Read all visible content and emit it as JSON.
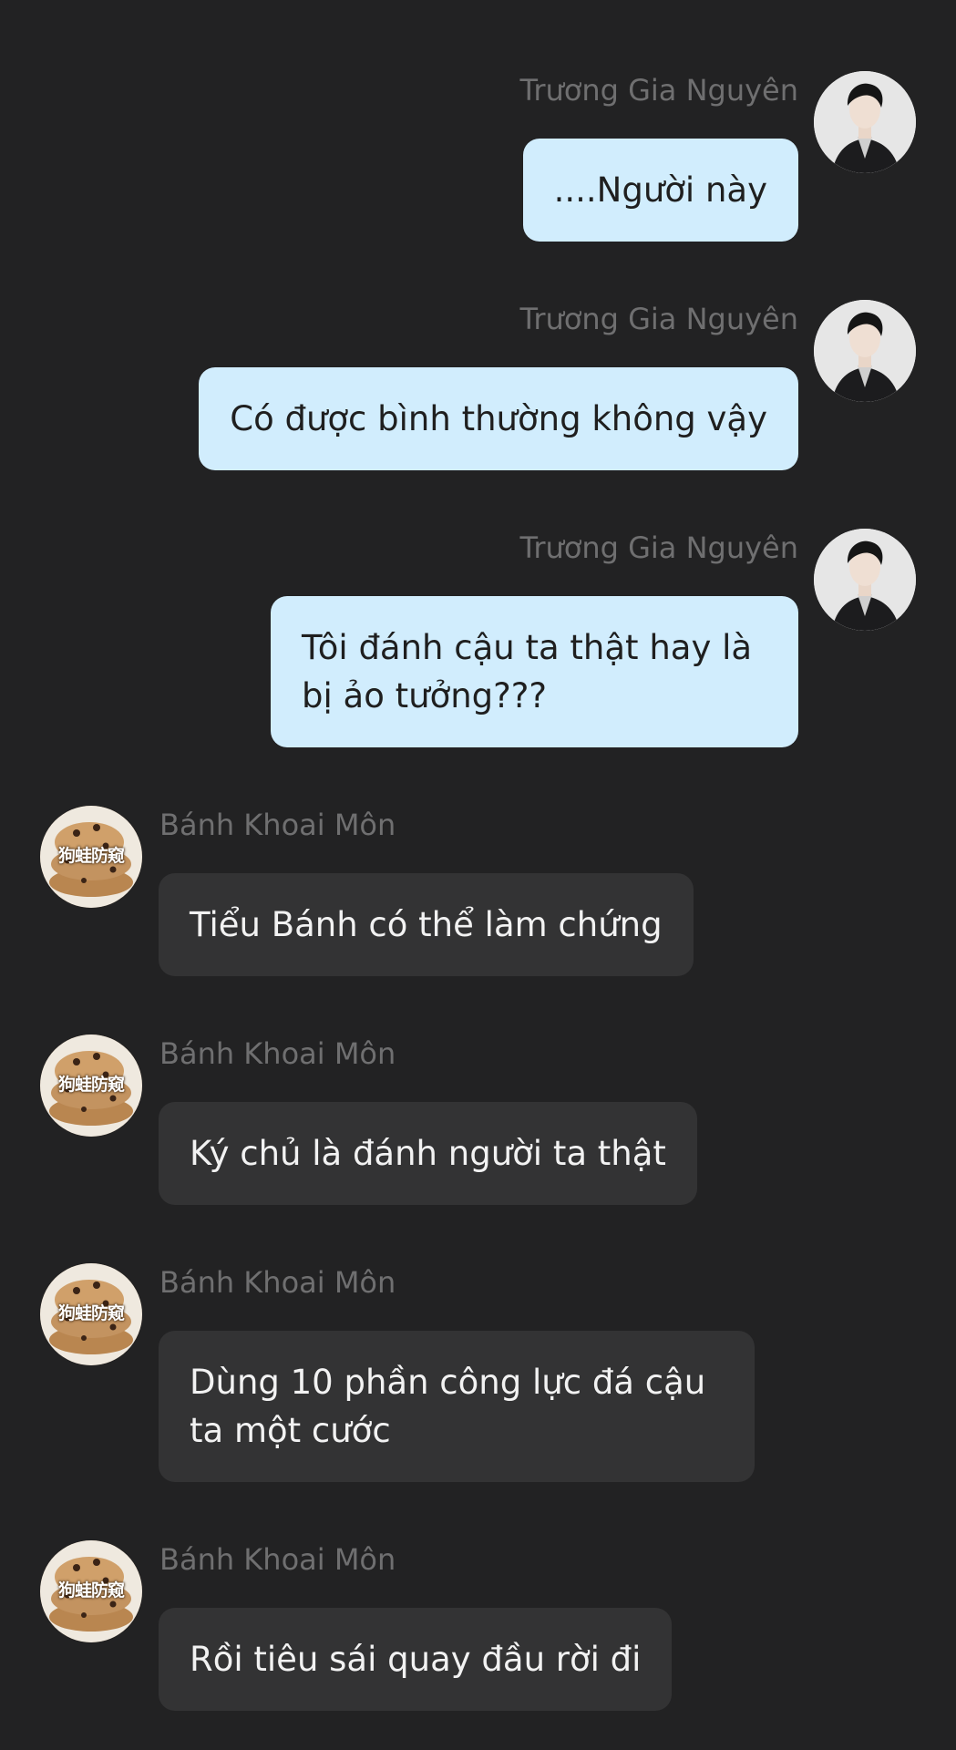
{
  "messages": [
    {
      "sender": "Trương Gia Nguyên",
      "side": "me",
      "text": "....Người này"
    },
    {
      "sender": "Trương Gia Nguyên",
      "side": "me",
      "text": "Có được bình thường không vậy"
    },
    {
      "sender": "Trương Gia Nguyên",
      "side": "me",
      "text": "Tôi đánh cậu ta thật hay là bị ảo tưởng???"
    },
    {
      "sender": "Bánh Khoai Môn",
      "side": "other",
      "text": "Tiểu Bánh có thể làm chứng",
      "avatar_caption": "狗蛙防窥"
    },
    {
      "sender": "Bánh Khoai Môn",
      "side": "other",
      "text": "Ký chủ là đánh người ta thật",
      "avatar_caption": "狗蛙防窥"
    },
    {
      "sender": "Bánh Khoai Môn",
      "side": "other",
      "text": "Dùng 10 phần công lực đá cậu ta một cước",
      "avatar_caption": "狗蛙防窥"
    },
    {
      "sender": "Bánh Khoai Môn",
      "side": "other",
      "text": "Rồi tiêu sái quay đầu rời đi",
      "avatar_caption": "狗蛙防窥"
    }
  ],
  "colors": {
    "background": "#222223",
    "my_bubble": "#d1edfd",
    "other_bubble": "#333334",
    "sender_name": "#6f6f70"
  },
  "icons": {
    "my_avatar": "man-portrait-avatar-icon",
    "other_avatar": "pastry-avatar-icon"
  }
}
